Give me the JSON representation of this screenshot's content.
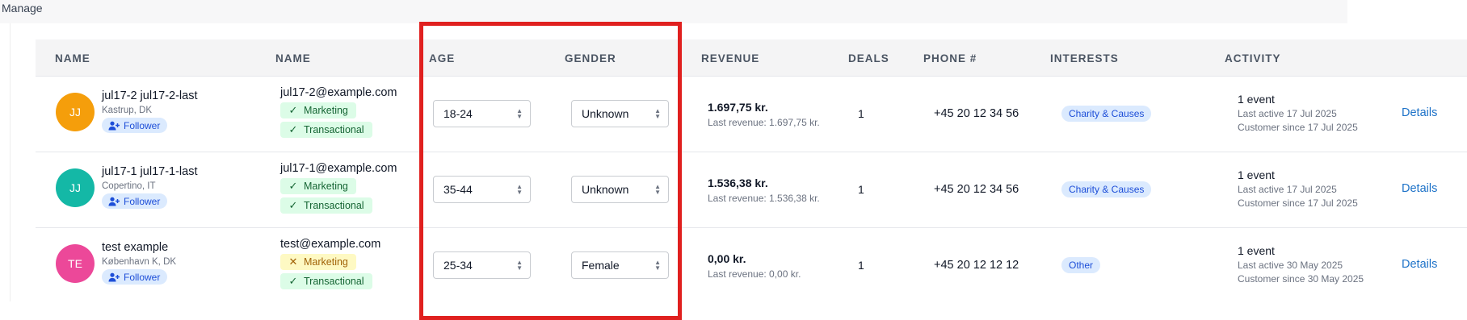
{
  "page": {
    "section_title": "Manage"
  },
  "columns": {
    "name1": "NAME",
    "name2": "NAME",
    "age": "AGE",
    "gender": "GENDER",
    "revenue": "REVENUE",
    "deals": "DEALS",
    "phone": "PHONE #",
    "interests": "INTERESTS",
    "activity": "ACTIVITY"
  },
  "rows": [
    {
      "initials": "JJ",
      "avatar_color": "#f59e0b",
      "name": "jul17-2 jul17-2-last",
      "location": "Kastrup, DK",
      "badge": "Follower",
      "email": "jul17-2@example.com",
      "marketing": {
        "label": "Marketing",
        "status": "check"
      },
      "transactional": {
        "label": "Transactional",
        "status": "check"
      },
      "age": "18-24",
      "gender": "Unknown",
      "revenue": "1.697,75 kr.",
      "last_revenue": "Last revenue: 1.697,75 kr.",
      "deals": "1",
      "phone": "+45 20 12 34 56",
      "interest": "Charity & Causes",
      "activity": "1 event",
      "last_active": "Last active 17 Jul 2025",
      "customer_since": "Customer since 17 Jul 2025",
      "details": "Details"
    },
    {
      "initials": "JJ",
      "avatar_color": "#14b8a6",
      "name": "jul17-1 jul17-1-last",
      "location": "Copertino, IT",
      "badge": "Follower",
      "email": "jul17-1@example.com",
      "marketing": {
        "label": "Marketing",
        "status": "check"
      },
      "transactional": {
        "label": "Transactional",
        "status": "check"
      },
      "age": "35-44",
      "gender": "Unknown",
      "revenue": "1.536,38 kr.",
      "last_revenue": "Last revenue: 1.536,38 kr.",
      "deals": "1",
      "phone": "+45 20 12 34 56",
      "interest": "Charity & Causes",
      "activity": "1 event",
      "last_active": "Last active 17 Jul 2025",
      "customer_since": "Customer since 17 Jul 2025",
      "details": "Details"
    },
    {
      "initials": "TE",
      "avatar_color": "#ec4899",
      "name": "test example",
      "location": "København K, DK",
      "badge": "Follower",
      "email": "test@example.com",
      "marketing": {
        "label": "Marketing",
        "status": "cross"
      },
      "transactional": {
        "label": "Transactional",
        "status": "check"
      },
      "age": "25-34",
      "gender": "Female",
      "revenue": "0,00 kr.",
      "last_revenue": "Last revenue: 0,00 kr.",
      "deals": "1",
      "phone": "+45 20 12 12 12",
      "interest": "Other",
      "activity": "1 event",
      "last_active": "Last active 30 May 2025",
      "customer_since": "Customer since 30 May 2025",
      "details": "Details"
    }
  ],
  "icons": {
    "check": "check-icon",
    "cross": "cross-icon",
    "follower": "user-plus-icon",
    "select_caret": "chevron-up-down-icon"
  },
  "colors": {
    "highlight": "#e0201f",
    "link": "#1d72c8",
    "ok_chip": "#dcfce7",
    "warn_chip": "#fef9c3",
    "badge": "#dbeafe"
  }
}
